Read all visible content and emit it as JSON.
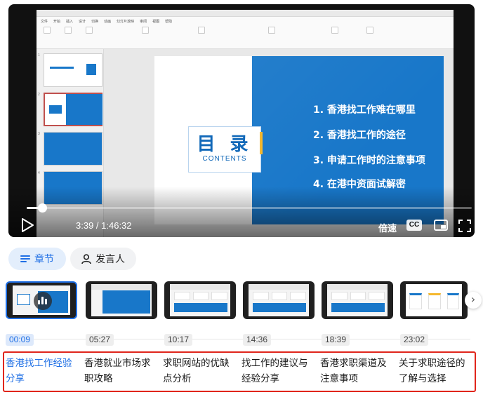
{
  "player": {
    "timecode": "3:39 / 1:46:32",
    "progress": 0.034,
    "speed_label": "倍速",
    "cc_label": "CC"
  },
  "slide": {
    "heading": "目 录",
    "subheading": "CONTENTS",
    "items": [
      "1. 香港找工作难在哪里",
      "2. 香港找工作的途径",
      "3. 申请工作时的注意事项",
      "4. 在港中资面试解密"
    ]
  },
  "ppt_ribbon_tabs": [
    "文件",
    "开始",
    "插入",
    "设计",
    "切换",
    "动画",
    "幻灯片放映",
    "审阅",
    "视图",
    "帮助"
  ],
  "tabs": {
    "chapters": "章节",
    "speakers": "发言人"
  },
  "chapters": [
    {
      "time": "00:09",
      "title": "香港找工作经验分享",
      "active": true
    },
    {
      "time": "05:27",
      "title": "香港就业市场求职攻略",
      "active": false
    },
    {
      "time": "10:17",
      "title": "求职网站的优缺点分析",
      "active": false
    },
    {
      "time": "14:36",
      "title": "找工作的建议与经验分享",
      "active": false
    },
    {
      "time": "18:39",
      "title": "香港求职渠道及注意事项",
      "active": false
    },
    {
      "time": "23:02",
      "title": "关于求职途径的了解与选择",
      "active": false
    }
  ],
  "icons": {
    "next": "chevron-right-icon",
    "play": "play-icon",
    "fullscreen": "fullscreen-icon",
    "pip": "picture-in-picture-icon",
    "chapters": "list-icon",
    "speakers": "person-icon"
  },
  "colors": {
    "accent": "#1f6fe5",
    "slide_blue": "#1877c9",
    "highlight_border": "#e0251b"
  }
}
